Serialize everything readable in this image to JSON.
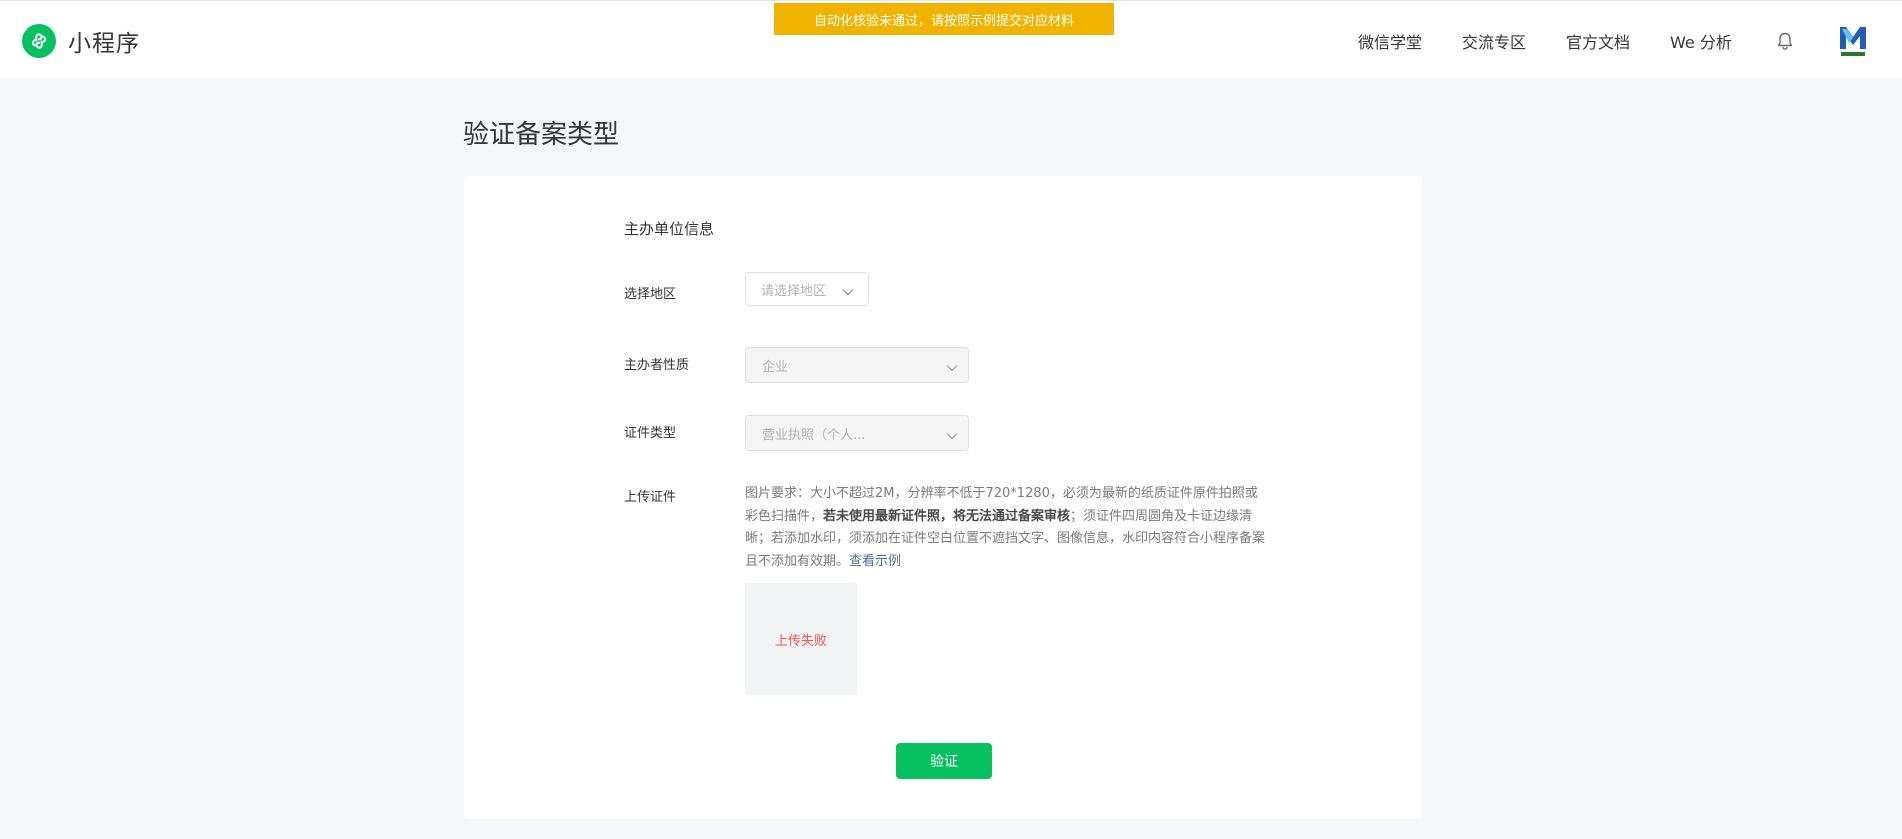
{
  "header": {
    "logo_text": "小程序",
    "notice": "自动化核验未通过，请按照示例提交对应材料",
    "nav": [
      "微信学堂",
      "交流专区",
      "官方文档",
      "We 分析"
    ]
  },
  "page": {
    "title": "验证备案类型"
  },
  "form": {
    "section_title": "主办单位信息",
    "region": {
      "label": "选择地区",
      "placeholder": "请选择地区"
    },
    "nature": {
      "label": "主办者性质",
      "value": "企业"
    },
    "cert_type": {
      "label": "证件类型",
      "value": "营业执照（个人..."
    },
    "upload": {
      "label": "上传证件",
      "desc_1": "图片要求：大小不超过2M，分辨率不低于720*1280，必须为最新的纸质证件原件拍照或彩色扫描件，",
      "desc_bold": "若未使用最新证件照，将无法通过备案审核",
      "desc_2": "；须证件四周圆角及卡证边缘清晰；若添加水印，须添加在证件空白位置不遮挡文字、图像信息，水印内容符合小程序备案且不添加有效期。",
      "example_link": "查看示例",
      "status": "上传失败"
    },
    "submit_label": "验证"
  },
  "colors": {
    "brand_green": "#07c160",
    "notice_bg": "#f0b400",
    "error_red": "#fa5151",
    "link_blue": "#576b95"
  },
  "icons": {
    "logo": "mini-program-logo-icon",
    "notification": "bell-icon",
    "dropdown": "chevron-down-icon"
  }
}
